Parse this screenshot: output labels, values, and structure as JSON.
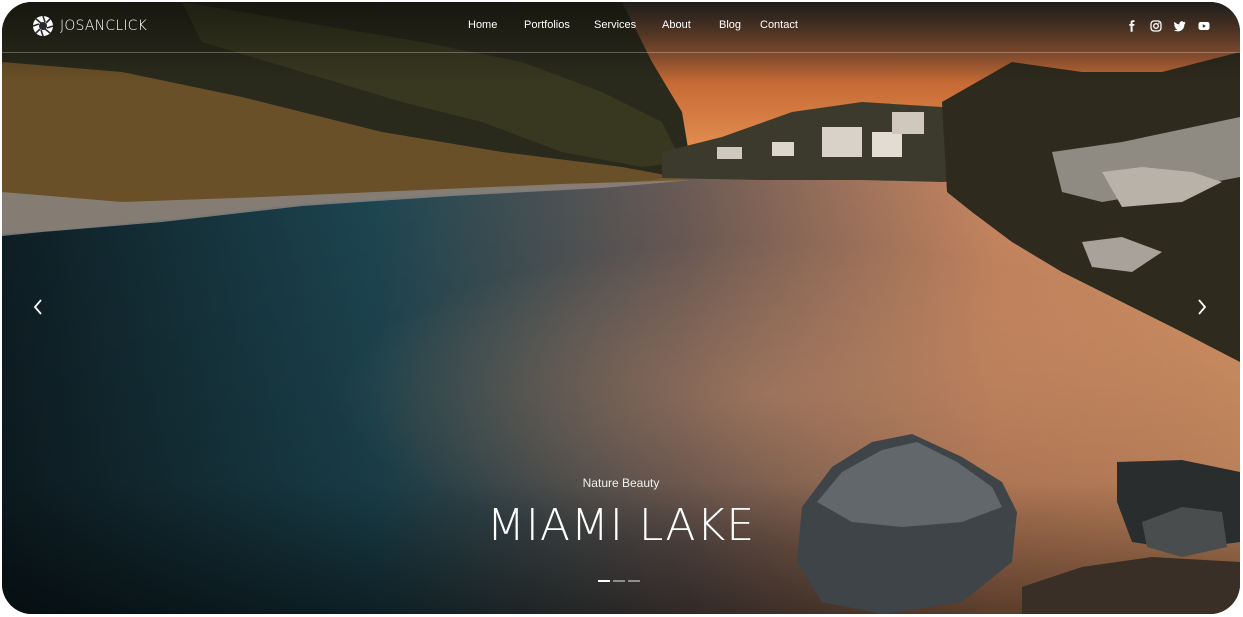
{
  "brand": {
    "name": "JOSANCLICK",
    "logo_icon": "aperture-icon"
  },
  "nav": {
    "items": [
      {
        "label": "Home"
      },
      {
        "label": "Portfolios"
      },
      {
        "label": "Services"
      },
      {
        "label": "About"
      },
      {
        "label": "Blog"
      },
      {
        "label": "Contact"
      }
    ]
  },
  "social": {
    "icons": [
      "facebook-icon",
      "instagram-icon",
      "twitter-icon",
      "youtube-icon"
    ]
  },
  "slider": {
    "subtitle": "Nature Beauty",
    "title": "MIAMI LAKE",
    "prev_icon": "chevron-left-icon",
    "next_icon": "chevron-right-icon",
    "total_slides": 3,
    "active_slide": 1
  },
  "colors": {
    "sky_sunset": "#e8894a",
    "water_teal": "#1f4e5a",
    "text_white": "#ffffff"
  }
}
